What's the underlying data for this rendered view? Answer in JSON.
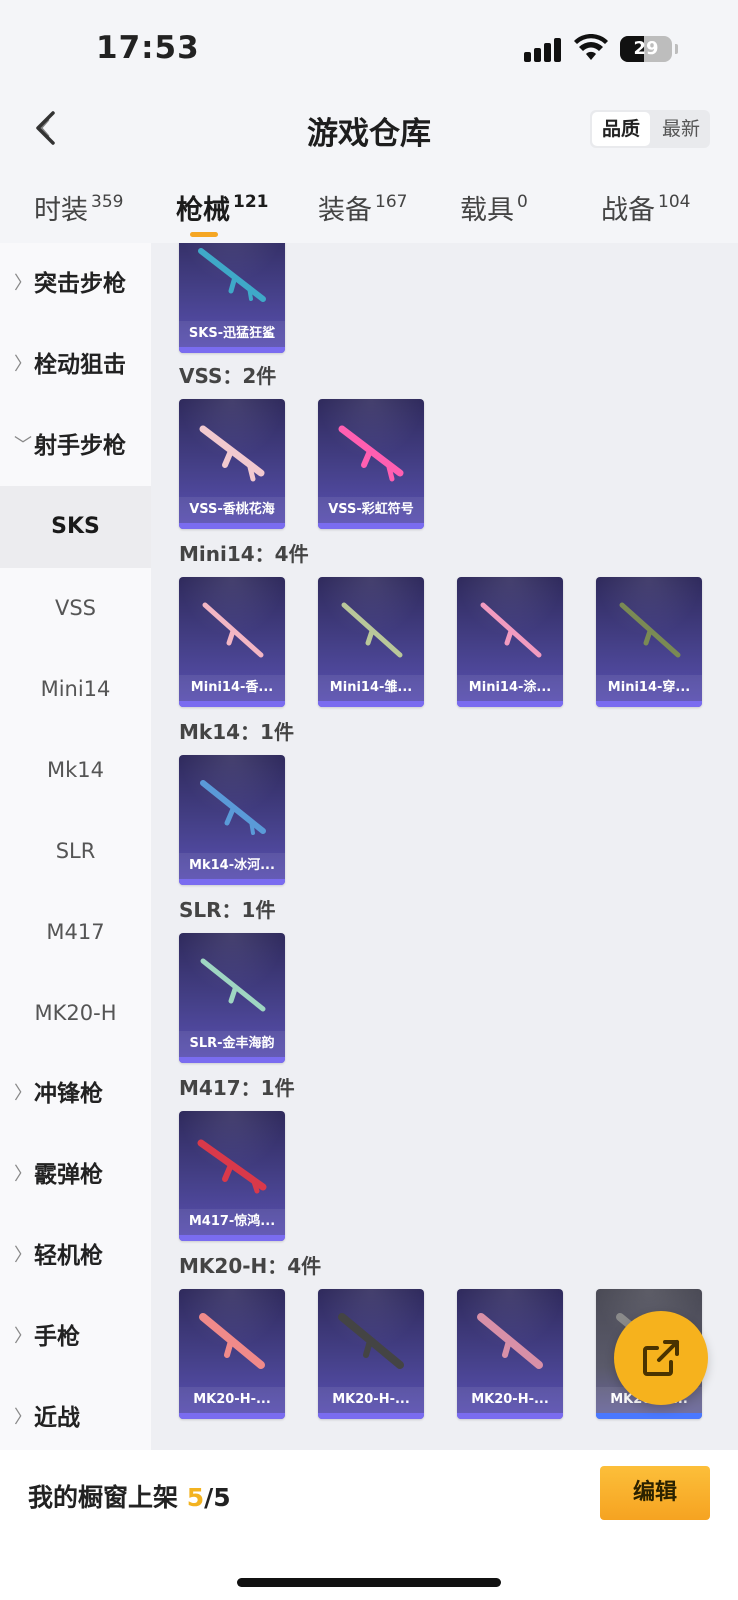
{
  "status": {
    "time": "17:53",
    "battery": "29"
  },
  "header": {
    "title": "游戏仓库",
    "sort": [
      "品质",
      "最新"
    ]
  },
  "tabs": [
    {
      "label": "时装",
      "count": "359"
    },
    {
      "label": "枪械",
      "count": "121",
      "active": true
    },
    {
      "label": "装备",
      "count": "167"
    },
    {
      "label": "载具",
      "count": "0"
    },
    {
      "label": "战备",
      "count": "104"
    }
  ],
  "sidebar": [
    {
      "label": "突击步枪",
      "type": "group",
      "expanded": false
    },
    {
      "label": "栓动狙击",
      "type": "group",
      "expanded": false
    },
    {
      "label": "射手步枪",
      "type": "group",
      "expanded": true
    },
    {
      "label": "SKS",
      "type": "sub",
      "selected": true
    },
    {
      "label": "VSS",
      "type": "sub"
    },
    {
      "label": "Mini14",
      "type": "sub"
    },
    {
      "label": "Mk14",
      "type": "sub"
    },
    {
      "label": "SLR",
      "type": "sub"
    },
    {
      "label": "M417",
      "type": "sub"
    },
    {
      "label": "MK20-H",
      "type": "sub"
    },
    {
      "label": "冲锋枪",
      "type": "group",
      "expanded": false
    },
    {
      "label": "霰弹枪",
      "type": "group",
      "expanded": false
    },
    {
      "label": "轻机枪",
      "type": "group",
      "expanded": false
    },
    {
      "label": "手枪",
      "type": "group",
      "expanded": false
    },
    {
      "label": "近战",
      "type": "group",
      "expanded": false
    }
  ],
  "sections": [
    {
      "title": "",
      "items": [
        {
          "name": "SKS-迅猛狂鲨",
          "color": "#3fa9c8"
        }
      ]
    },
    {
      "title": "VSS：2件",
      "items": [
        {
          "name": "VSS-香桃花海",
          "color": "#f2c9cf"
        },
        {
          "name": "VSS-彩虹符号",
          "color": "#ff5fb1"
        }
      ]
    },
    {
      "title": "Mini14：4件",
      "items": [
        {
          "name": "Mini14-香...",
          "color": "#f3b6c4"
        },
        {
          "name": "Mini14-雏...",
          "color": "#b9c79a"
        },
        {
          "name": "Mini14-涂...",
          "color": "#f29bc0"
        },
        {
          "name": "Mini14-穿...",
          "color": "#7a8a54"
        }
      ]
    },
    {
      "title": "Mk14：1件",
      "items": [
        {
          "name": "Mk14-冰河...",
          "color": "#5a9ad8"
        }
      ]
    },
    {
      "title": "SLR：1件",
      "items": [
        {
          "name": "SLR-金丰海韵",
          "color": "#9fd6c2"
        }
      ]
    },
    {
      "title": "M417：1件",
      "items": [
        {
          "name": "M417-惊鸿...",
          "color": "#d9394a"
        }
      ]
    },
    {
      "title": "MK20-H：4件",
      "items": [
        {
          "name": "MK20-H-...",
          "color": "#f08a8a"
        },
        {
          "name": "MK20-H-...",
          "color": "#444444"
        },
        {
          "name": "MK20-H-...",
          "color": "#d890a8"
        },
        {
          "name": "MK20-H-...",
          "color": "#8a8a8a"
        }
      ]
    }
  ],
  "bottom": {
    "shelf_label": "我的橱窗上架",
    "shelf_current": "5",
    "shelf_total": "/5",
    "edit_label": "编辑"
  },
  "colors": {
    "accent": "#f5a623",
    "card_bg": "#46418a"
  }
}
